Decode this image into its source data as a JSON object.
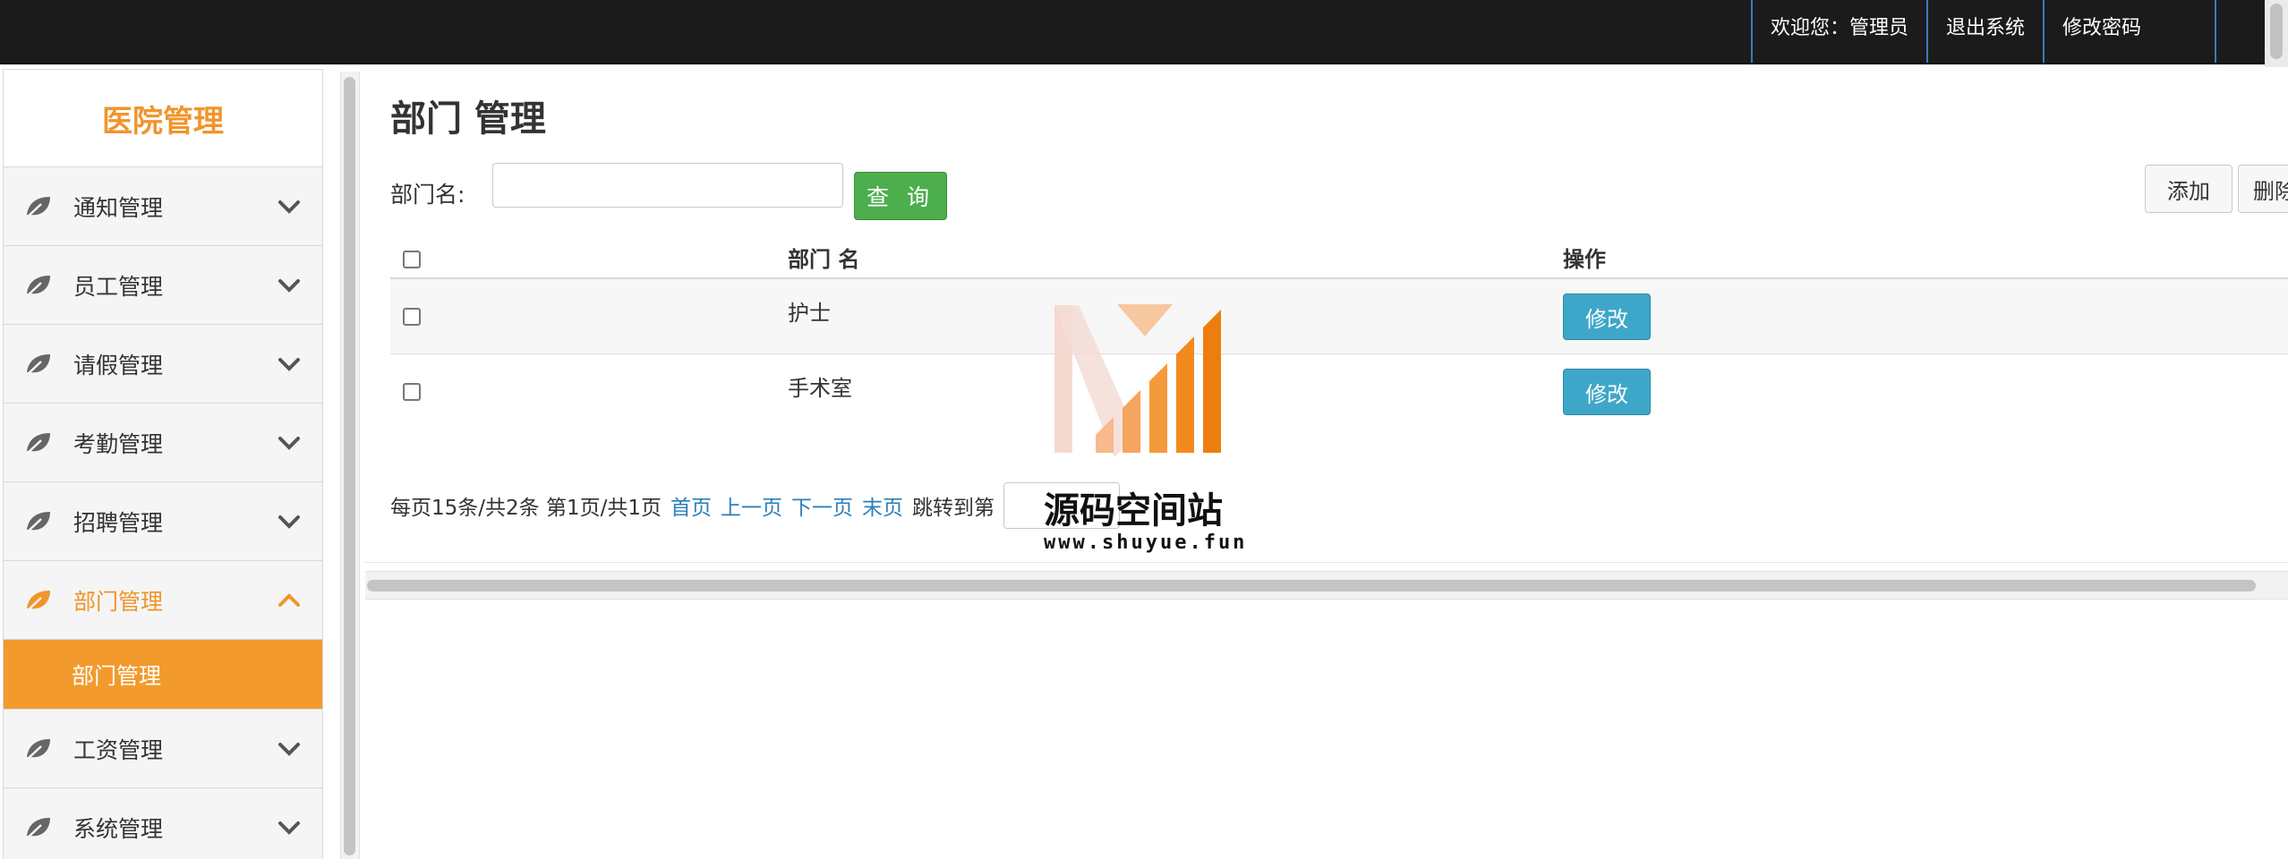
{
  "topbar": {
    "welcome": "欢迎您：管理员",
    "logout": "退出系统",
    "change_password": "修改密码"
  },
  "sidebar": {
    "title": "医院管理",
    "accent_color": "#f0952c",
    "items": [
      {
        "label": "通知管理",
        "icon": "leaf-icon",
        "expanded": false
      },
      {
        "label": "员工管理",
        "icon": "leaf-icon",
        "expanded": false
      },
      {
        "label": "请假管理",
        "icon": "leaf-icon",
        "expanded": false
      },
      {
        "label": "考勤管理",
        "icon": "leaf-icon",
        "expanded": false
      },
      {
        "label": "招聘管理",
        "icon": "leaf-icon",
        "expanded": false
      },
      {
        "label": "部门管理",
        "icon": "leaf-icon",
        "expanded": true
      },
      {
        "label": "工资管理",
        "icon": "leaf-icon",
        "expanded": false
      },
      {
        "label": "系统管理",
        "icon": "leaf-icon",
        "expanded": false
      }
    ],
    "active_subitem": "部门管理"
  },
  "main": {
    "title": "部门 管理",
    "search": {
      "label": "部门名:",
      "value": "",
      "query_button": "查 询"
    },
    "toolbar": {
      "add_button": "添加",
      "delete_button": "删除"
    },
    "table": {
      "headers": [
        "部门 名",
        "操作"
      ],
      "rows": [
        {
          "name": "护士",
          "action": "修改"
        },
        {
          "name": "手术室",
          "action": "修改"
        }
      ]
    },
    "pager": {
      "summary": "每页15条/共2条 第1页/共1页",
      "first": "首页",
      "prev": "上一页",
      "next": "下一页",
      "last": "末页",
      "jump_label": "跳转到第"
    }
  },
  "watermark": {
    "text": "源码空间站",
    "url": "www.shuyue.fun"
  }
}
